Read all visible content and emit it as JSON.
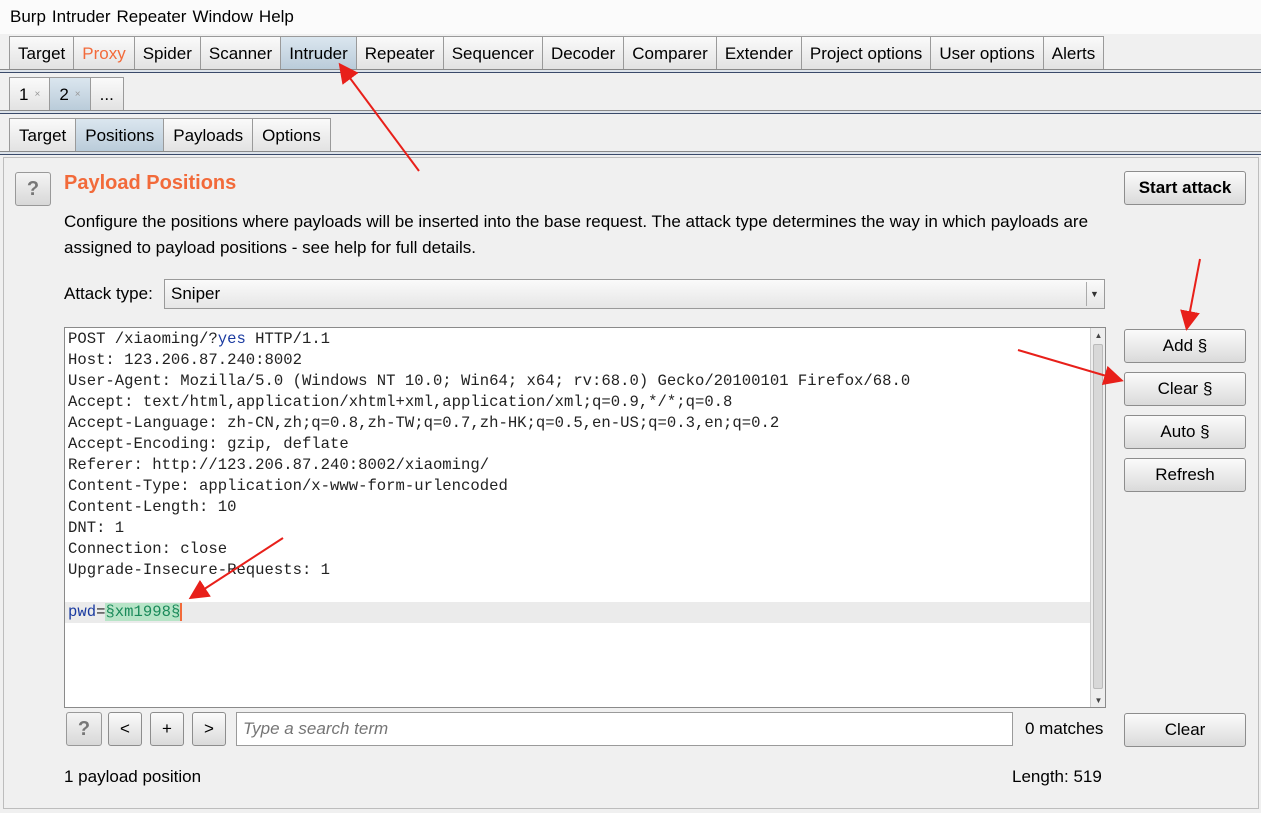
{
  "menu": [
    "Burp",
    "Intruder",
    "Repeater",
    "Window",
    "Help"
  ],
  "main_tabs": [
    "Target",
    "Proxy",
    "Spider",
    "Scanner",
    "Intruder",
    "Repeater",
    "Sequencer",
    "Decoder",
    "Comparer",
    "Extender",
    "Project options",
    "User options",
    "Alerts"
  ],
  "instance_tabs": [
    {
      "label": "1",
      "close": "×"
    },
    {
      "label": "2",
      "close": "×"
    },
    {
      "label": "..."
    }
  ],
  "sub_tabs": [
    "Target",
    "Positions",
    "Payloads",
    "Options"
  ],
  "section": {
    "help": "?",
    "title": "Payload Positions",
    "description": "Configure the positions where payloads will be inserted into the base request. The attack type determines the way in which payloads are assigned to payload positions - see help for full details.",
    "start_attack": "Start attack",
    "attack_type_label": "Attack type:",
    "attack_type_value": "Sniper"
  },
  "request": {
    "line1_a": "POST /xiaoming/?",
    "line1_kw": "yes",
    "line1_b": " HTTP/1.1",
    "headers": [
      "Host: 123.206.87.240:8002",
      "User-Agent: Mozilla/5.0 (Windows NT 10.0; Win64; x64; rv:68.0) Gecko/20100101 Firefox/68.0",
      "Accept: text/html,application/xhtml+xml,application/xml;q=0.9,*/*;q=0.8",
      "Accept-Language: zh-CN,zh;q=0.8,zh-TW;q=0.7,zh-HK;q=0.5,en-US;q=0.3,en;q=0.2",
      "Accept-Encoding: gzip, deflate",
      "Referer: http://123.206.87.240:8002/xiaoming/",
      "Content-Type: application/x-www-form-urlencoded",
      "Content-Length: 10",
      "DNT: 1",
      "Connection: close",
      "Upgrade-Insecure-Requests: 1"
    ],
    "body_param": "pwd",
    "body_eq": "=",
    "body_marked": "§xm1998§"
  },
  "side_buttons": {
    "add": "Add §",
    "clear": "Clear §",
    "auto": "Auto §",
    "refresh": "Refresh"
  },
  "search": {
    "help": "?",
    "prev": "<",
    "add": "+",
    "next": ">",
    "placeholder": "Type a search term",
    "matches": "0 matches",
    "clear": "Clear"
  },
  "status": {
    "positions": "1 payload position",
    "length": "Length: 519"
  },
  "colors": {
    "accent": "#f26a3a",
    "arrow": "#e8201a",
    "marker_bg": "#b7e4c7"
  }
}
